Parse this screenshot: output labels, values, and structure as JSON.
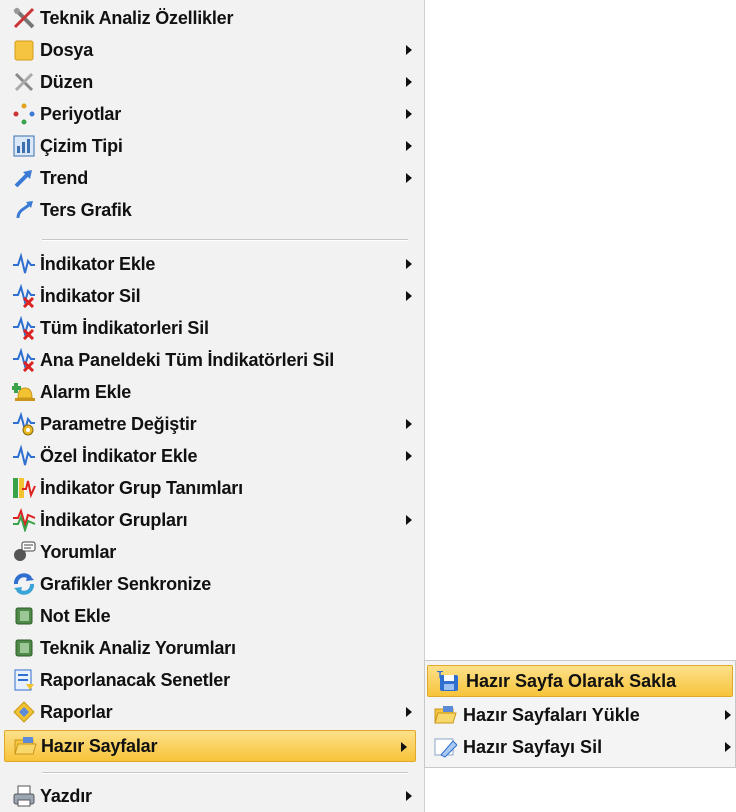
{
  "menu": {
    "items": [
      {
        "label": "Teknik Analiz Özellikler",
        "icon": "tools-icon",
        "submenu": false
      },
      {
        "label": "Dosya",
        "icon": "folder-icon",
        "submenu": true
      },
      {
        "label": "Düzen",
        "icon": "wrench-icon",
        "submenu": true
      },
      {
        "label": "Periyotlar",
        "icon": "cycle-icon",
        "submenu": true
      },
      {
        "label": "Çizim Tipi",
        "icon": "chart-type-icon",
        "submenu": true
      },
      {
        "label": "Trend",
        "icon": "trend-arrow-icon",
        "submenu": true
      },
      {
        "label": "Ters Grafik",
        "icon": "reverse-icon",
        "submenu": false
      },
      {
        "label": "İndikator Ekle",
        "icon": "indicator-icon",
        "submenu": true
      },
      {
        "label": "İndikator Sil",
        "icon": "indicator-delete-icon",
        "submenu": true
      },
      {
        "label": "Tüm İndikatorleri Sil",
        "icon": "indicator-delete-icon",
        "submenu": false
      },
      {
        "label": "Ana Paneldeki Tüm İndikatörleri Sil",
        "icon": "indicator-delete-icon",
        "submenu": false
      },
      {
        "label": "Alarm Ekle",
        "icon": "alarm-add-icon",
        "submenu": false
      },
      {
        "label": "Parametre Değiştir",
        "icon": "indicator-gear-icon",
        "submenu": true
      },
      {
        "label": "Özel İndikator Ekle",
        "icon": "indicator-icon",
        "submenu": true
      },
      {
        "label": "İndikator Grup Tanımları",
        "icon": "indicator-group-icon",
        "submenu": false
      },
      {
        "label": "İndikator Grupları",
        "icon": "indicator-groups-icon",
        "submenu": true
      },
      {
        "label": "Yorumlar",
        "icon": "comments-icon",
        "submenu": false
      },
      {
        "label": "Grafikler Senkronize",
        "icon": "sync-icon",
        "submenu": false
      },
      {
        "label": "Not Ekle",
        "icon": "note-icon",
        "submenu": false
      },
      {
        "label": "Teknik Analiz Yorumları",
        "icon": "note-icon",
        "submenu": false
      },
      {
        "label": "Raporlanacak Senetler",
        "icon": "report-list-icon",
        "submenu": false
      },
      {
        "label": "Raporlar",
        "icon": "report-icon",
        "submenu": true
      },
      {
        "label": "Hazır Sayfalar",
        "icon": "open-folder-icon",
        "submenu": true
      },
      {
        "label": "Yazdır",
        "icon": "printer-icon",
        "submenu": true
      }
    ]
  },
  "submenu": {
    "items": [
      {
        "label": "Hazır Sayfa Olarak Sakla",
        "icon": "save-icon",
        "submenu": false
      },
      {
        "label": "Hazır Sayfaları Yükle",
        "icon": "open-folder-icon",
        "submenu": true
      },
      {
        "label": "Hazır Sayfayı Sil",
        "icon": "eraser-icon",
        "submenu": true
      }
    ]
  },
  "colors": {
    "highlight_top": "#fde089",
    "highlight_bottom": "#f7c43a",
    "menu_bg": "#f2f2f2"
  }
}
